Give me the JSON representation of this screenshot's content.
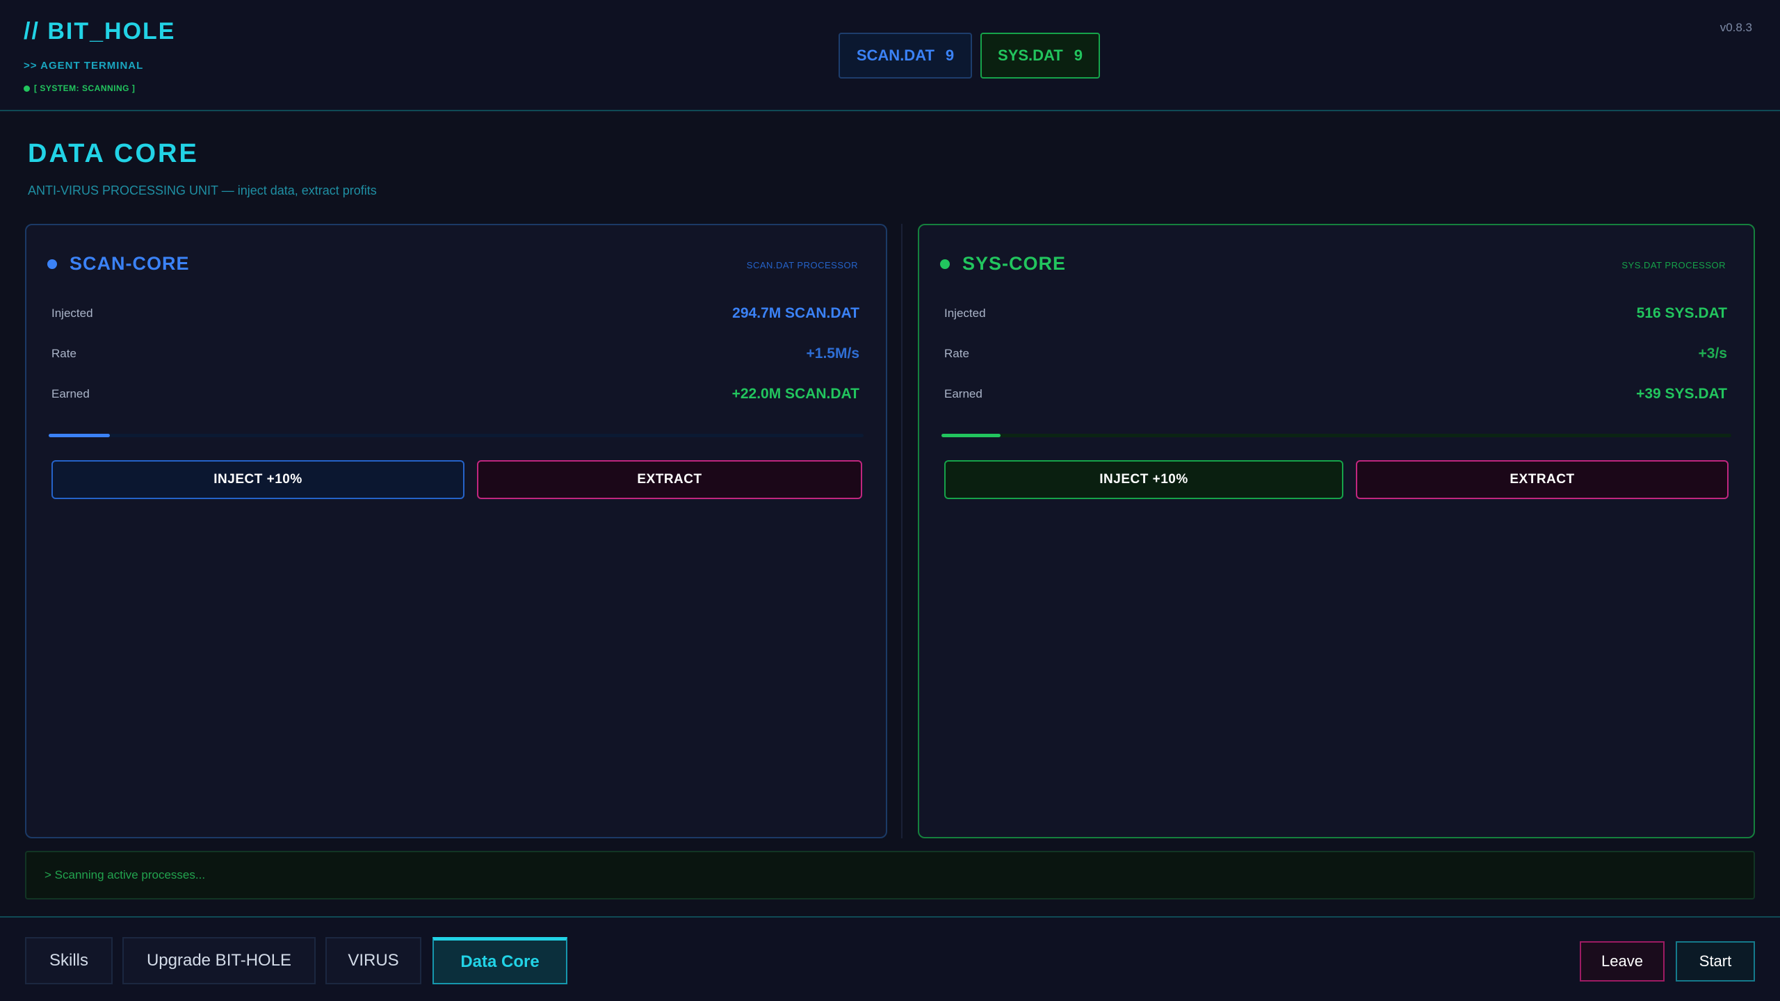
{
  "header": {
    "title": "// BIT_HOLE",
    "subtitle": ">> AGENT TERMINAL",
    "status": "[ SYSTEM: SCANNING ]",
    "version": "v0.8.3"
  },
  "resources": [
    {
      "name": "SCAN.DAT",
      "value": "9"
    },
    {
      "name": "SYS.DAT",
      "value": "9"
    }
  ],
  "page": {
    "title": "DATA CORE",
    "subtitle": "ANTI-VIRUS PROCESSING UNIT — inject data, extract profits"
  },
  "cores": [
    {
      "name": "SCAN-CORE",
      "tag": "SCAN.DAT PROCESSOR",
      "stats": [
        {
          "label": "Injected",
          "value": "294.7M SCAN.DAT"
        },
        {
          "label": "Rate",
          "value": "+1.5M/s"
        },
        {
          "label": "Earned",
          "value": "+22.0M SCAN.DAT"
        }
      ],
      "progress": 0.075,
      "inject_label": "INJECT +10%",
      "extract_label": "EXTRACT"
    },
    {
      "name": "SYS-CORE",
      "tag": "SYS.DAT PROCESSOR",
      "stats": [
        {
          "label": "Injected",
          "value": "516 SYS.DAT"
        },
        {
          "label": "Rate",
          "value": "+3/s"
        },
        {
          "label": "Earned",
          "value": "+39 SYS.DAT"
        }
      ],
      "progress": 0.075,
      "inject_label": "INJECT +10%",
      "extract_label": "EXTRACT"
    }
  ],
  "log": "> Scanning active processes...",
  "nav": {
    "tabs": [
      {
        "label": "Skills"
      },
      {
        "label": "Upgrade BIT-HOLE"
      },
      {
        "label": "VIRUS"
      },
      {
        "label": "Data Core"
      }
    ],
    "active_tab": "Data Core",
    "leave_label": "Leave",
    "start_label": "Start"
  },
  "colors": {
    "accent": "#22d3e6",
    "scan": "#3b82f6",
    "sys": "#22c55e",
    "extract": "#c0267f"
  }
}
